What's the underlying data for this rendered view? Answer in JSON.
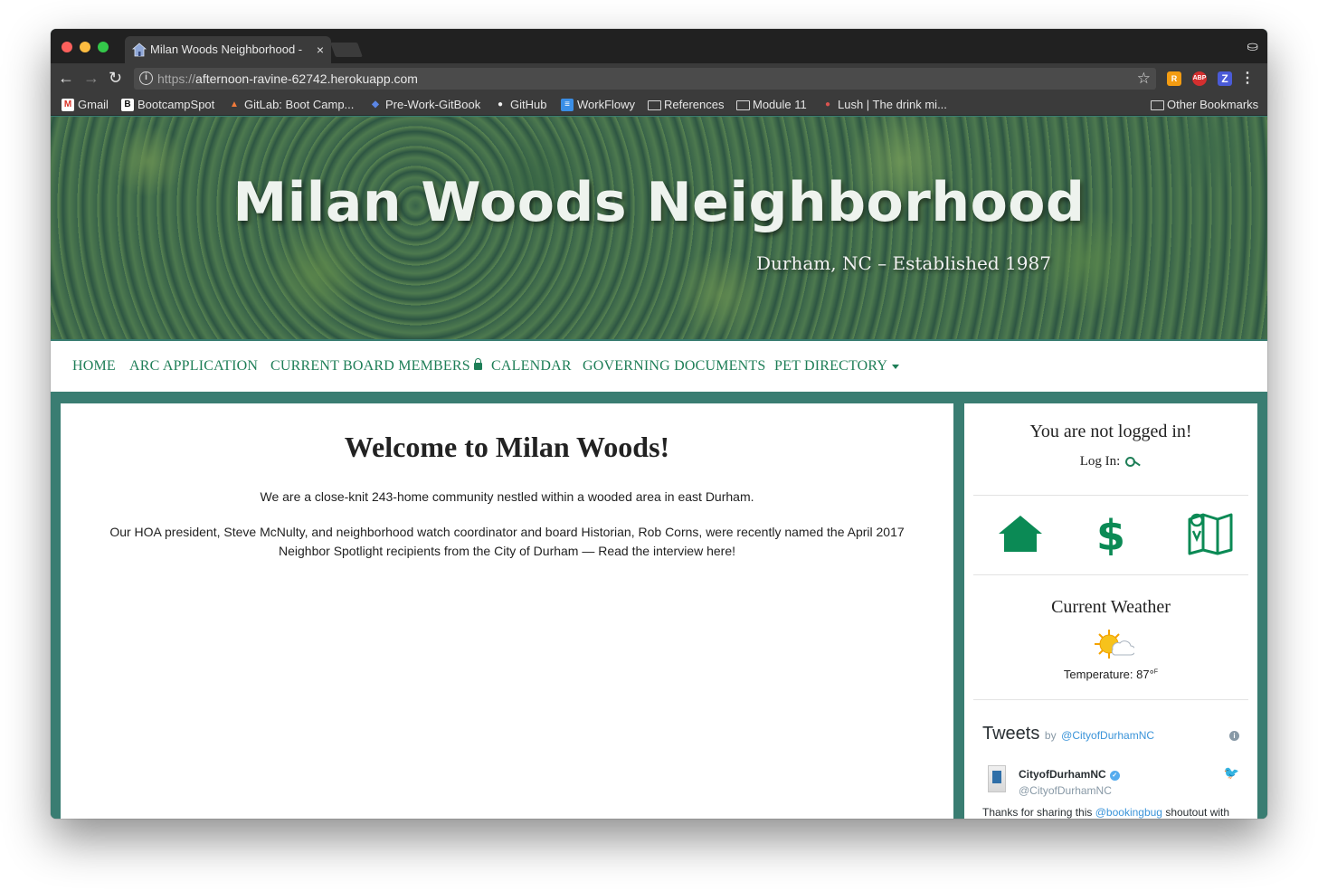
{
  "browser": {
    "tab_title": "Milan Woods Neighborhood -",
    "tab_close": "×",
    "url_scheme": "https://",
    "url_host": "afternoon-ravine-62742.herokuapp.com",
    "bookmarks": [
      {
        "label": "Gmail",
        "icon": "gmail-icon",
        "color": "#d93025",
        "glyph": "M"
      },
      {
        "label": "BootcampSpot",
        "icon": "bootcampspot-icon",
        "color": "#111111",
        "glyph": "B"
      },
      {
        "label": "GitLab: Boot Camp...",
        "icon": "gitlab-icon",
        "color": "#e24329",
        "glyph": "▲"
      },
      {
        "label": "Pre-Work-GitBook",
        "icon": "gitbook-icon",
        "color": "#3a63c8",
        "glyph": "◆"
      },
      {
        "label": "GitHub",
        "icon": "github-icon",
        "color": "#222222",
        "glyph": "●"
      },
      {
        "label": "WorkFlowy",
        "icon": "workflowy-icon",
        "color": "#3a8ee6",
        "glyph": "≡"
      },
      {
        "label": "References",
        "icon": "folder-icon"
      },
      {
        "label": "Module 11",
        "icon": "folder-icon"
      },
      {
        "label": "Lush | The drink mi...",
        "icon": "lush-icon",
        "color": "#c0392b",
        "glyph": "●"
      }
    ],
    "other_bookmarks": "Other Bookmarks",
    "extensions": [
      "R",
      "ABP",
      "Z"
    ]
  },
  "site": {
    "title": "Milan Woods Neighborhood",
    "subtitle": "Durham, NC – Established 1987",
    "nav": [
      {
        "label": "HOME"
      },
      {
        "label": "ARC APPLICATION"
      },
      {
        "label": "CURRENT BOARD MEMBERS"
      },
      {
        "label": "CALENDAR"
      },
      {
        "label": "GOVERNING DOCUMENTS"
      },
      {
        "label": "PET DIRECTORY"
      }
    ],
    "accent_color": "#1e7e57",
    "frame_color": "#3a7d72"
  },
  "main": {
    "heading": "Welcome to Milan Woods!",
    "paragraph1": "We are a close-knit 243-home community nestled within a wooded area in east Durham.",
    "paragraph2": "Our HOA president, Steve McNulty, and neighborhood watch coordinator and board Historian, Rob Corns, were recently named the April 2017 Neighbor Spotlight recipients from the City of Durham — Read the interview here!"
  },
  "sidebar": {
    "login_title": "You are not logged in!",
    "login_label": "Log In:",
    "quick_links": [
      "home-icon",
      "dollar-icon",
      "map-icon"
    ],
    "weather_title": "Current Weather",
    "temperature_label": "Temperature: 87°",
    "temperature_unit": "F",
    "tweets": {
      "heading": "Tweets",
      "by": "by",
      "handle": "@CityofDurhamNC",
      "author_name": "CityofDurhamNC",
      "author_handle": "@CityofDurhamNC",
      "text_prefix": "Thanks for sharing this ",
      "text_mention": "@bookingbug",
      "text_suffix": " shoutout with"
    }
  }
}
